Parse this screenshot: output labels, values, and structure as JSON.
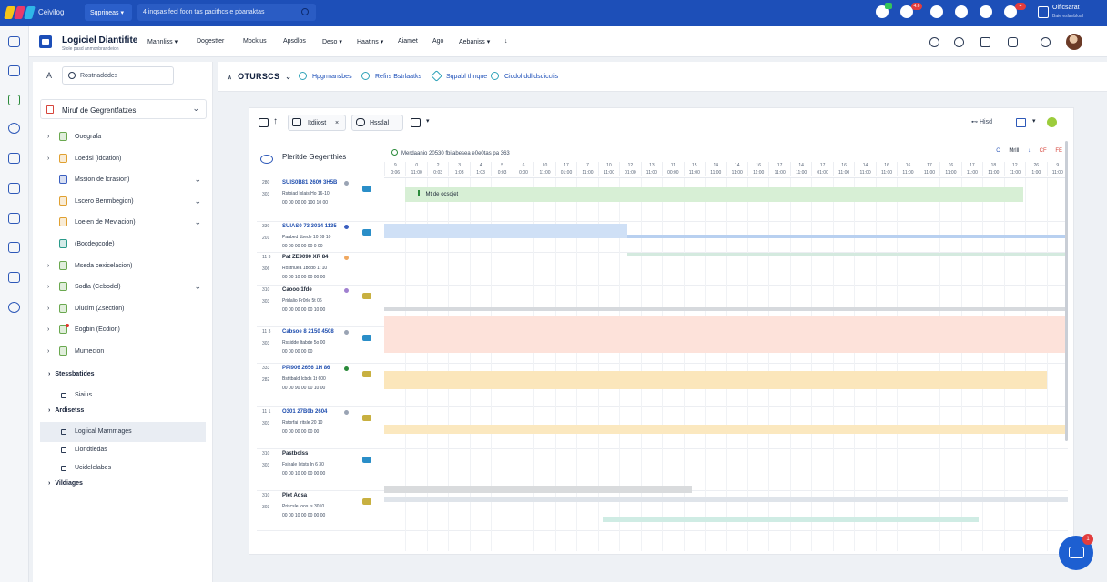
{
  "topbar": {
    "app_name": "Ceivilog",
    "workspace": "Sqprineas",
    "search_text": "4 inqsas fecl foon tas pacithcs e pbanaktas",
    "notification_badge": "4.6",
    "alert_badge": "4",
    "user_name": "Olficsarat",
    "user_role": "Baie eslanbloal"
  },
  "header": {
    "title": "Logiciel Diantifite",
    "subtitle": "Stole pasd anmonbrandeion",
    "nav": [
      {
        "label": "Mannliss",
        "dropdown": true
      },
      {
        "label": "Dogestter",
        "dropdown": false
      },
      {
        "label": "Mocklus",
        "dropdown": false
      },
      {
        "label": "Apsdlos",
        "dropdown": false
      },
      {
        "label": "Deso",
        "dropdown": true
      },
      {
        "label": "Haatins",
        "dropdown": true
      },
      {
        "label": "Aiamet",
        "dropdown": false
      },
      {
        "label": "Ago",
        "dropdown": false
      },
      {
        "label": "Aebaniss",
        "dropdown": true
      },
      {
        "label": "↓",
        "dropdown": false
      }
    ]
  },
  "left_panel": {
    "collapse_label": "A",
    "search_text": "Rostnadddes",
    "project_select": "Miruf de Gegrentfatzes",
    "tree": [
      {
        "label": "Ooegrafa",
        "color": "#6aa84f",
        "chevron": false,
        "caret": true,
        "badge": false
      },
      {
        "label": "Loedsi (idcation)",
        "color": "#e0a030",
        "chevron": false,
        "caret": true,
        "badge": false
      },
      {
        "label": "Mssion de lcrasion)",
        "color": "#3b5fc0",
        "chevron": true,
        "caret": false,
        "badge": false
      },
      {
        "label": "Lscero Benmbegion)",
        "color": "#e0a030",
        "chevron": true,
        "caret": false,
        "badge": false
      },
      {
        "label": "Loelen de Mevlacion)",
        "color": "#e0a030",
        "chevron": true,
        "caret": false,
        "badge": false
      },
      {
        "label": "(Bocdegcode)",
        "color": "#2a9a8a",
        "chevron": false,
        "caret": false,
        "badge": false
      },
      {
        "label": "Mseda cexicelacion)",
        "color": "#6aa84f",
        "chevron": false,
        "caret": true,
        "badge": false
      },
      {
        "label": "Sodla (Cebodel)",
        "color": "#6aa84f",
        "chevron": true,
        "caret": true,
        "badge": false
      },
      {
        "label": "Diucim (Zsection)",
        "color": "#6aa84f",
        "chevron": false,
        "caret": true,
        "badge": false
      },
      {
        "label": "Eogbin (Ecdion)",
        "color": "#6aa84f",
        "chevron": false,
        "caret": true,
        "badge": true
      },
      {
        "label": "Mumecion",
        "color": "#6aa84f",
        "chevron": false,
        "caret": true,
        "badge": false
      }
    ],
    "sections": [
      {
        "label": "Stessbatides",
        "items": [
          {
            "label": "Siaius",
            "active": false
          }
        ]
      },
      {
        "label": "Ardisetss",
        "items": [
          {
            "label": "Loglical Marnmages",
            "active": true
          },
          {
            "label": "Liondtiedas",
            "active": false
          },
          {
            "label": "Ucidelelabes",
            "active": false
          }
        ]
      },
      {
        "label": "Vildiages",
        "items": []
      }
    ]
  },
  "content_bar": {
    "title": "OTURSCS",
    "tabs": [
      "Hpgrmansbes",
      "Refirs Bstrlaatks",
      "Sqpabl thnqne",
      "Cicdol ddlidsdicctis"
    ]
  },
  "toolbar": {
    "chip1": "Itdiiost",
    "chip1_close": "×",
    "chip2": "Hsstlal",
    "chip3": "▾",
    "right_label": "Hisd"
  },
  "gantt": {
    "list_title": "Pleritde Gegenthies",
    "header_label": "Merdaanio 20530 fbilabesea e0e0tas pa 363",
    "header_right": [
      "C",
      "Mrlll",
      "↓",
      "CF",
      "FE"
    ],
    "columns": [
      {
        "d": "9",
        "t": "0:06"
      },
      {
        "d": "0",
        "t": "11:00"
      },
      {
        "d": "2",
        "t": "0:03"
      },
      {
        "d": "3",
        "t": "1:03"
      },
      {
        "d": "4",
        "t": "1:03"
      },
      {
        "d": "5",
        "t": "0:03"
      },
      {
        "d": "6",
        "t": "0:00"
      },
      {
        "d": "10",
        "t": "11:00"
      },
      {
        "d": "17",
        "t": "01:00"
      },
      {
        "d": "7",
        "t": "11:00"
      },
      {
        "d": "10",
        "t": "11:00"
      },
      {
        "d": "12",
        "t": "01:00"
      },
      {
        "d": "13",
        "t": "11:00"
      },
      {
        "d": "11",
        "t": "00:00"
      },
      {
        "d": "15",
        "t": "11:00"
      },
      {
        "d": "14",
        "t": "11:00"
      },
      {
        "d": "14",
        "t": "11:00"
      },
      {
        "d": "16",
        "t": "11:00"
      },
      {
        "d": "17",
        "t": "11:00"
      },
      {
        "d": "14",
        "t": "11:00"
      },
      {
        "d": "17",
        "t": "01:00"
      },
      {
        "d": "16",
        "t": "11:00"
      },
      {
        "d": "14",
        "t": "11:00"
      },
      {
        "d": "16",
        "t": "11:00"
      },
      {
        "d": "16",
        "t": "11:00"
      },
      {
        "d": "17",
        "t": "11:00"
      },
      {
        "d": "16",
        "t": "11:00"
      },
      {
        "d": "17",
        "t": "11:00"
      },
      {
        "d": "18",
        "t": "11:00"
      },
      {
        "d": "12",
        "t": "11:00"
      },
      {
        "d": "26",
        "t": "1:00"
      },
      {
        "d": "9",
        "t": "11:00"
      }
    ],
    "tasks": [
      {
        "id1": "280",
        "id2": "303",
        "name": "SUIS0B81 2609 3H5B",
        "line2": "Rstoiad Ixlais Ho 16-10",
        "line3": "00 00 00 00 100 10 00",
        "dot": "#9aa4b4",
        "icon": "#2a8ec8",
        "blue": true,
        "h": 48
      },
      {
        "id1": "330",
        "id2": "201",
        "name": "SUIAS0 73 3014 1135",
        "line2": "Paabed 1bede 10 69 10",
        "line3": "00 00 00 00 00 0 00",
        "dot": "#3b5fc0",
        "icon": "#2a8ec8",
        "blue": true,
        "h": 34
      },
      {
        "id1": "11 3",
        "id2": "306",
        "name": "Pat ZE9090 XR 84",
        "line2": "Rostriuea 1bodo 1t 10",
        "line3": "00 00 10 00 00 00 00",
        "dot": "#f0a860",
        "icon": "",
        "blue": false,
        "h": 36
      },
      {
        "id1": "310",
        "id2": "303",
        "name": "Caooo 1fde",
        "line2": "Prirlalio Fr0rle 5t 06",
        "line3": "00 00 00 00 00 10 00",
        "dot": "#a080d0",
        "icon": "#c8b040",
        "blue": false,
        "h": 46
      },
      {
        "id1": "11 3",
        "id2": "303",
        "name": "Cabsoe 8 2150 4508",
        "line2": "Rssidde Itabde 5o 00",
        "line3": "00 00 00 00 00",
        "dot": "#9aa4b4",
        "icon": "#2a8ec8",
        "blue": true,
        "h": 40
      },
      {
        "id1": "333",
        "id2": "282",
        "name": "PPI906 2656 1H 86",
        "line2": "Bstitbald Icbds 1t 600",
        "line3": "00 00 90 00 00 10 00",
        "dot": "#2a8a3a",
        "icon": "#c8b040",
        "blue": true,
        "h": 48
      },
      {
        "id1": "11 1",
        "id2": "303",
        "name": "O301 27B0b 2604",
        "line2": "Rstorfai Iritsle 20 10",
        "line3": "00 00 00 00 00 00",
        "dot": "#9aa4b4",
        "icon": "#c8b040",
        "blue": true,
        "h": 46
      },
      {
        "id1": "310",
        "id2": "303",
        "name": "Pastbolss",
        "line2": "Fsinale Ixtsts In 6 30",
        "line3": "00 00 10 00 00 00 00",
        "dot": "",
        "icon": "#2a8ec8",
        "blue": false,
        "h": 46
      },
      {
        "id1": "310",
        "id2": "303",
        "name": "Plet Aqsa",
        "line2": "Priscsle Ioos Is 3010",
        "line3": "00 00 10 00 00 00 00",
        "dot": "",
        "icon": "#c8b040",
        "blue": false,
        "h": 44
      }
    ],
    "bars": [
      {
        "label": "Mt de ocsojet",
        "start": 0.03,
        "end": 0.935,
        "row": 0,
        "offset": 10,
        "h": 16,
        "color": "#d7efd5"
      },
      {
        "label": "",
        "start": 0.0,
        "end": 0.355,
        "row": 1,
        "offset": 2,
        "h": 16,
        "color": "#cfe0f6"
      },
      {
        "label": "",
        "start": 0.355,
        "end": 1.0,
        "row": 1,
        "offset": 14,
        "h": 4,
        "color": "#b8d0f0"
      },
      {
        "label": "",
        "start": 0.355,
        "end": 1.0,
        "row": 2,
        "offset": 0,
        "h": 3,
        "color": "#d4eadf"
      },
      {
        "label": "",
        "start": 0.0,
        "end": 1.0,
        "row": 3,
        "offset": 24,
        "h": 4,
        "color": "#d6d9dd"
      },
      {
        "label": "",
        "start": 0.0,
        "end": 1.0,
        "row": 4,
        "offset": -12,
        "h": 40,
        "color": "#fde2da"
      },
      {
        "label": "",
        "start": 0.0,
        "end": 0.97,
        "row": 5,
        "offset": 8,
        "h": 20,
        "color": "#fbe6bb"
      },
      {
        "label": "",
        "start": 0.0,
        "end": 1.0,
        "row": 6,
        "offset": 19,
        "h": 10,
        "color": "#fbe8bf"
      },
      {
        "label": "",
        "start": 0.0,
        "end": 0.45,
        "row": 7,
        "offset": 40,
        "h": 8,
        "color": "#d9dbdd"
      },
      {
        "label": "",
        "start": 0.0,
        "end": 1.0,
        "row": 8,
        "offset": 6,
        "h": 6,
        "color": "#dfe4ea"
      },
      {
        "label": "",
        "start": 0.32,
        "end": 0.87,
        "row": 8,
        "offset": 28,
        "h": 6,
        "color": "#cfece4"
      }
    ]
  },
  "chat": {
    "badge": "1"
  },
  "colors": {
    "primary": "#1d4fb8",
    "accent": "#1d5fd1",
    "alert": "#e23d3d"
  }
}
